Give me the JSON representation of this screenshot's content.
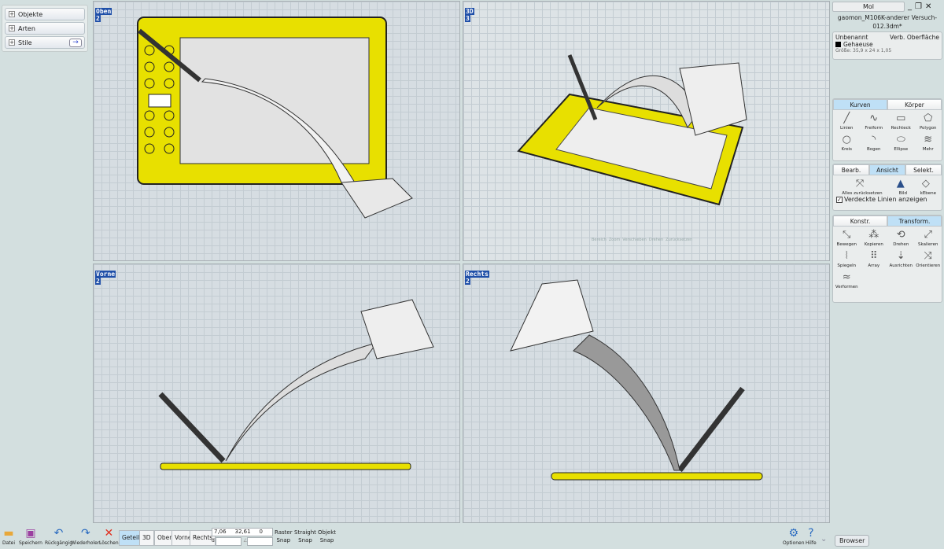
{
  "left_panel": {
    "items": [
      {
        "label": "Objekte"
      },
      {
        "label": "Arten"
      },
      {
        "label": "Stile"
      }
    ]
  },
  "viewports": [
    {
      "name": "Oben",
      "number": "2"
    },
    {
      "name": "3D",
      "number": "3"
    },
    {
      "name": "Vorne",
      "number": "2"
    },
    {
      "name": "Rechts",
      "number": "2"
    }
  ],
  "nav_overlay": [
    "Bereich",
    "Zoom",
    "Verschieben",
    "Drehen",
    "Zurücksetzen"
  ],
  "right_panel": {
    "mol_button": "Mol",
    "filename": "gaomon_M106K-anderer Versuch-012.3dm*",
    "object": {
      "name": "Unbenannt",
      "type": "Verb. Oberfläche",
      "layer": "Gehaeuse",
      "layer_color": "#000000",
      "size": "Größe: 35,9 x 24 x 1,05"
    },
    "curve_tabs": [
      "Kurven",
      "Körper"
    ],
    "curve_tools": [
      {
        "label": "Linien",
        "icon": "╱"
      },
      {
        "label": "Freiform",
        "icon": "∿"
      },
      {
        "label": "Rechteck",
        "icon": "▭"
      },
      {
        "label": "Polygon",
        "icon": "⬠"
      },
      {
        "label": "Kreis",
        "icon": "○"
      },
      {
        "label": "Bogen",
        "icon": "◝"
      },
      {
        "label": "Ellipse",
        "icon": "⬭"
      },
      {
        "label": "Mehr",
        "icon": "≋"
      }
    ],
    "view_tabs": [
      "Bearb.",
      "Ansicht",
      "Selekt."
    ],
    "view_tools": [
      {
        "label": "Alles zurücksetzen",
        "icon": "⤧"
      },
      {
        "label": "Bild",
        "icon": "▲"
      },
      {
        "label": "kEbene",
        "icon": "◇"
      }
    ],
    "checkbox_label": "Verdeckte Linien anzeigen",
    "transform_tabs": [
      "Konstr.",
      "Transform."
    ],
    "transform_tools": [
      {
        "label": "Bewegen",
        "icon": "⤡"
      },
      {
        "label": "Kopieren",
        "icon": "⁂"
      },
      {
        "label": "Drehen",
        "icon": "⟲"
      },
      {
        "label": "Skalieren",
        "icon": "⤢"
      },
      {
        "label": "Spiegeln",
        "icon": "⦚"
      },
      {
        "label": "Array",
        "icon": "⠿"
      },
      {
        "label": "Ausrichten",
        "icon": "⇣"
      },
      {
        "label": "Orientieren",
        "icon": "⤨"
      },
      {
        "label": "Verformen",
        "icon": "≈"
      }
    ]
  },
  "bottom": {
    "buttons": [
      {
        "label": "Datei",
        "icon": "▬",
        "color": "#e8a83a"
      },
      {
        "label": "Speichern",
        "icon": "▣",
        "color": "#9b3fa0"
      },
      {
        "label": "Rückgängig",
        "icon": "↶",
        "color": "#2a6bc0"
      },
      {
        "label": "Wiederholen",
        "icon": "↷",
        "color": "#2a6bc0"
      },
      {
        "label": "Löschen",
        "icon": "✕",
        "color": "#e03020"
      }
    ],
    "view_buttons": [
      "Geteilt",
      "3D",
      "Oben",
      "Vorne",
      "Rechts"
    ],
    "coords": {
      "x": "7,06",
      "y": "32,61",
      "z": "0",
      "d_label": "d",
      "angle_label": "∠",
      "d": "",
      "angle": ""
    },
    "snaps": [
      [
        "Raster",
        "Snap"
      ],
      [
        "Straight",
        "Snap"
      ],
      [
        "Objekt",
        "Snap"
      ]
    ],
    "options": "Optionen",
    "help": "Hilfe",
    "browser": "Browser"
  },
  "colors": {
    "tablet": "#e8e000",
    "accent": "#bfe0f6"
  }
}
